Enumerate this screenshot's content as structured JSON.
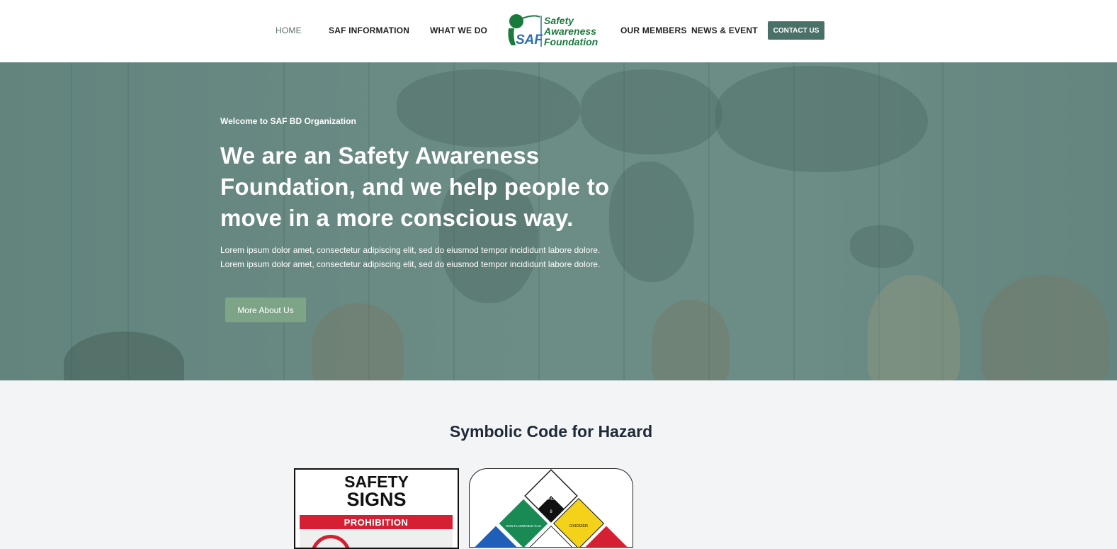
{
  "nav": {
    "home": "HOME",
    "saf_information": "SAF INFORMATION",
    "what_we_do": "WHAT WE DO",
    "our_members": "OUR MEMBERS",
    "news_event": "NEWS & EVENT",
    "contact": "CONTACT US"
  },
  "logo": {
    "mark": "SAF",
    "line1": "Safety",
    "line2": "Awareness",
    "line3": "Foundation"
  },
  "hero": {
    "kicker": "Welcome to SAF BD Organization",
    "title": "We are an Safety Awareness Foundation, and we help people to move in a more conscious way.",
    "body_line1": "Lorem ipsum dolor amet, consectetur adipiscing elit, sed do eiusmod tempor incididunt labore dolore.",
    "body_line2": "Lorem ipsum dolor amet, consectetur adipiscing elit, sed do eiusmod tempor incididunt labore dolore.",
    "button": "More About Us"
  },
  "section": {
    "title": "Symbolic Code for Hazard"
  },
  "cards": {
    "signs": {
      "word1": "SAFETY",
      "word2": "SIGNS",
      "banner": "PROHIBITION"
    },
    "hazard": {
      "corrosive": "CORROSIVE",
      "gas": "NON-FLAMMABLE GAS",
      "oxidizer": "OXIDIZER",
      "class_8": "8"
    }
  },
  "colors": {
    "accent": "#4a7168",
    "hero_button": "#7ea488",
    "prohibition_red": "#d42032",
    "logo_green": "#1a7a3c",
    "logo_blue": "#2c6fb0"
  }
}
